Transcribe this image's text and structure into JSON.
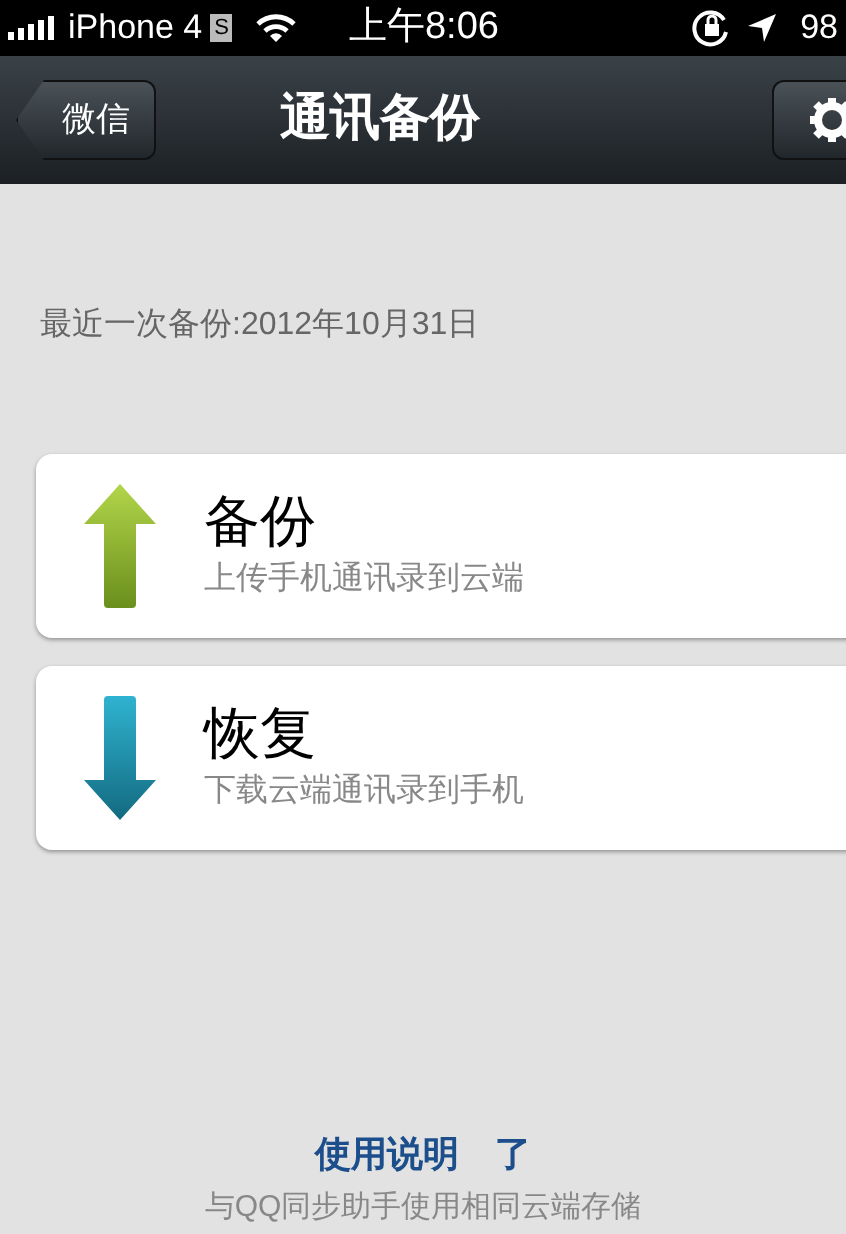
{
  "status_bar": {
    "carrier": "iPhone 4",
    "carrier_badge": "S",
    "time": "上午8:06",
    "battery": "98"
  },
  "nav_bar": {
    "back": "微信",
    "title": "通讯备份"
  },
  "last_backup": "最近一次备份:2012年10月31日",
  "actions": [
    {
      "kind": "upload",
      "title": "备份",
      "subtitle": "上传手机通讯录到云端"
    },
    {
      "kind": "download",
      "title": "恢复",
      "subtitle": "下载云端通讯录到手机"
    }
  ],
  "links": [
    "使用说明",
    "了"
  ],
  "footer_note": "与QQ同步助手使用相同云端存储"
}
